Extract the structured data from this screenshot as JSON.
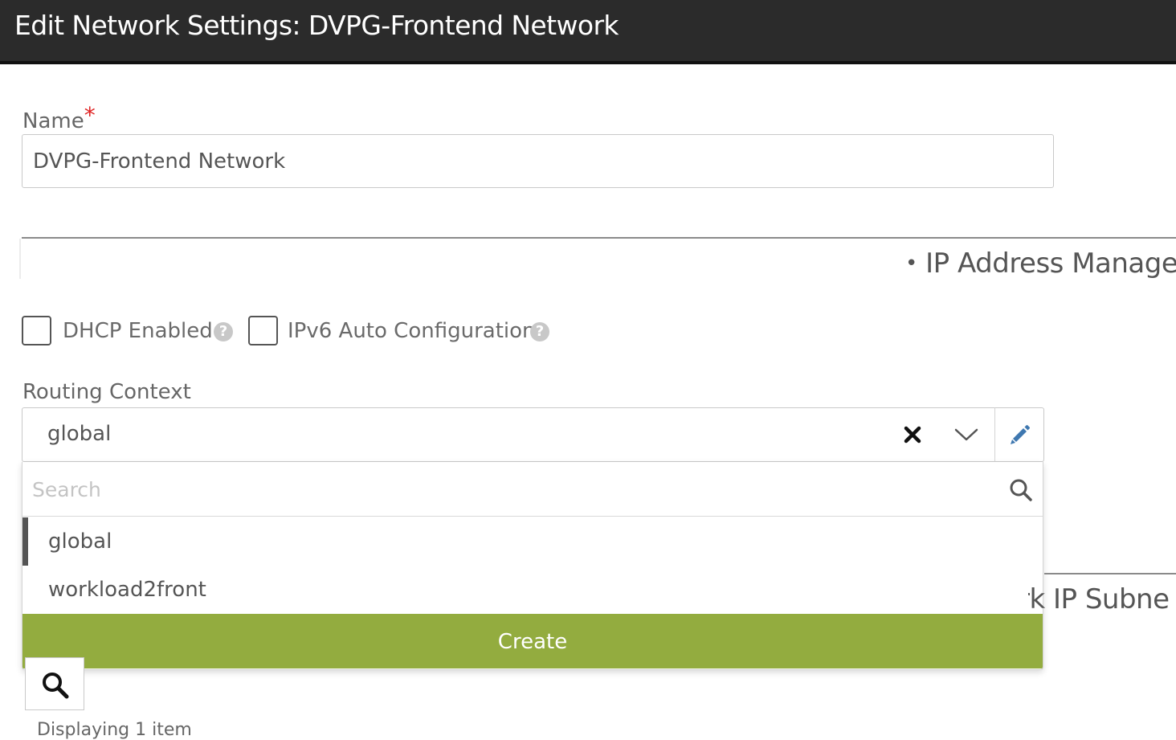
{
  "header": {
    "title": "Edit Network Settings: DVPG-Frontend Network"
  },
  "name_field": {
    "label": "Name",
    "required_mark": "*",
    "value": "DVPG-Frontend Network"
  },
  "ip_section": {
    "bullet": "•",
    "title": "IP Address Managen"
  },
  "checkboxes": [
    {
      "label": "DHCP Enabled",
      "checked": false,
      "help": "?"
    },
    {
      "label": "IPv6 Auto Configuration",
      "checked": false,
      "help": "?"
    }
  ],
  "routing_context": {
    "label": "Routing Context",
    "selected": "global",
    "search_placeholder": "Search",
    "options": [
      "global",
      "workload2front"
    ],
    "create_label": "Create"
  },
  "background": {
    "subnet_section_title": "rk IP Subne",
    "display_text": "Displaying 1 item"
  },
  "colors": {
    "header_bg": "#2b2b2b",
    "accent_green": "#93ac3f",
    "required_red": "#e02424"
  }
}
